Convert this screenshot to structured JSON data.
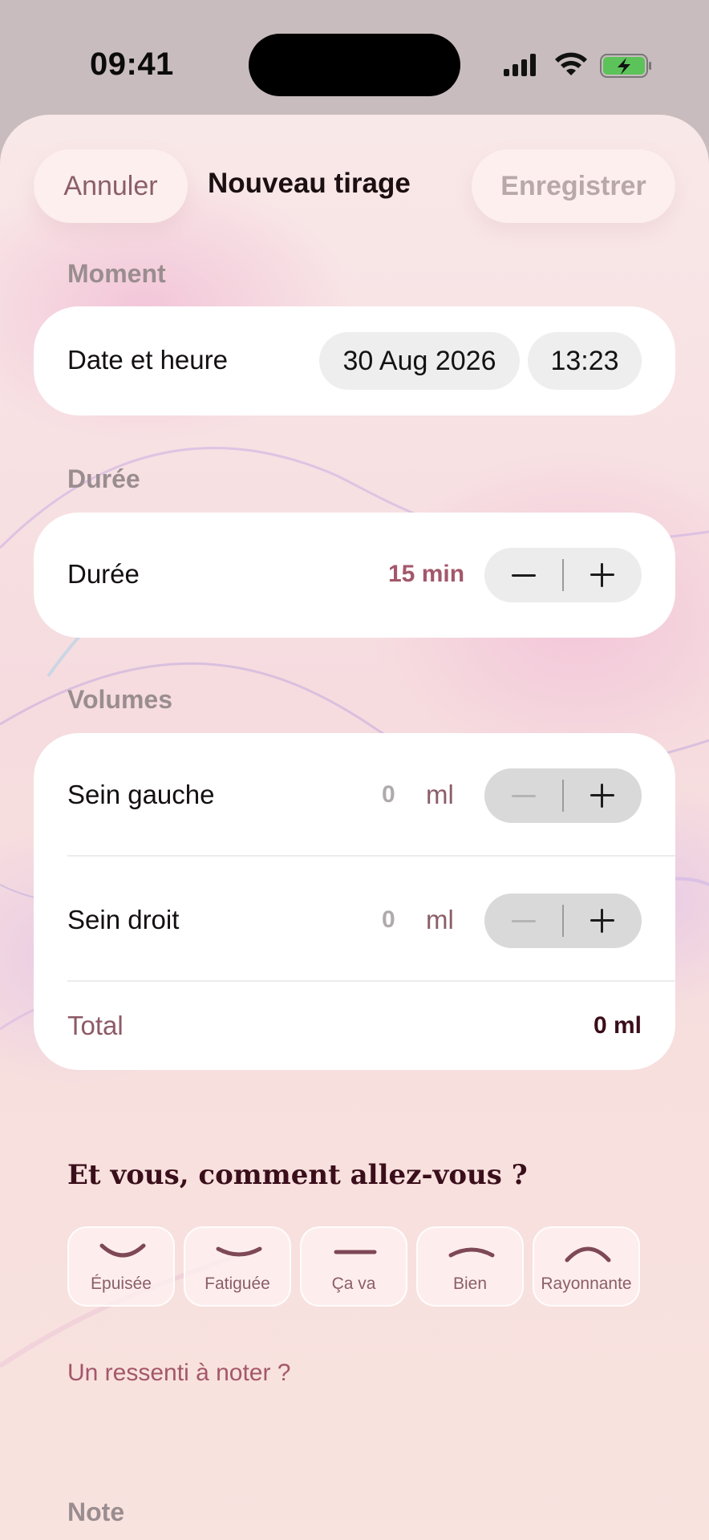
{
  "status_bar": {
    "time": "09:41"
  },
  "header": {
    "cancel_label": "Annuler",
    "title": "Nouveau tirage",
    "save_label": "Enregistrer"
  },
  "moment": {
    "section_label": "Moment",
    "row_label": "Date et heure",
    "date_value": "30 Aug 2026",
    "time_value": "13:23"
  },
  "duration": {
    "section_label": "Durée",
    "row_label": "Durée",
    "value": "15 min"
  },
  "volumes": {
    "section_label": "Volumes",
    "left_label": "Sein gauche",
    "left_value": "0",
    "right_label": "Sein droit",
    "right_value": "0",
    "unit": "ml",
    "total_label": "Total",
    "total_value": "0 ml"
  },
  "mood": {
    "question": "Et vous, comment allez-vous ?",
    "options": [
      {
        "label": "Épuisée",
        "icon": "frown-deep-icon"
      },
      {
        "label": "Fatiguée",
        "icon": "frown-icon"
      },
      {
        "label": "Ça va",
        "icon": "neutral-icon"
      },
      {
        "label": "Bien",
        "icon": "smile-icon"
      },
      {
        "label": "Rayonnante",
        "icon": "smile-wide-icon"
      }
    ]
  },
  "feeling_link": "Un ressenti à noter ?",
  "note": {
    "section_label": "Note"
  },
  "colors": {
    "accent": "#a4576a",
    "sheet_background": "#f8e2e3",
    "status_bar_background": "#c8bcbe"
  }
}
